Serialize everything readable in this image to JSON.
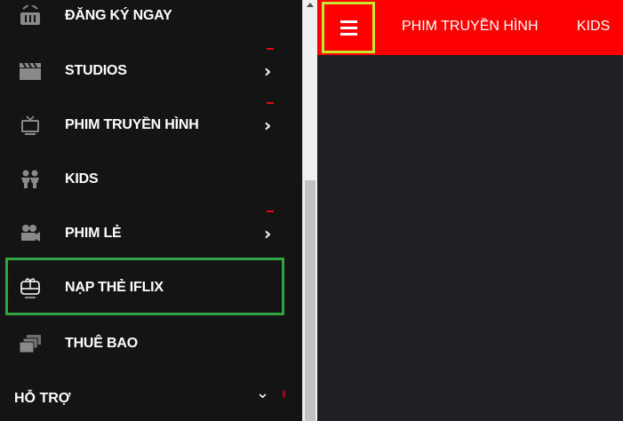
{
  "sidebar": {
    "items": [
      {
        "label": "ĐĂNG KÝ NGAY",
        "icon": "basket-icon"
      },
      {
        "label": "STUDIOS",
        "icon": "clapperboard-icon"
      },
      {
        "label": "PHIM TRUYỀN HÌNH",
        "icon": "tv-icon"
      },
      {
        "label": "KIDS",
        "icon": "kids-icon"
      },
      {
        "label": "PHIM LẺ",
        "icon": "movie-camera-icon"
      },
      {
        "label": "NẠP THẺ IFLIX",
        "icon": "gift-card-icon"
      },
      {
        "label": "THUÊ BAO",
        "icon": "subscription-stack-icon"
      }
    ],
    "support_label": "HỖ TRỢ",
    "chevron_right": "›",
    "chevron_down": "⌄"
  },
  "topbar": {
    "nav": [
      "PHIM TRUYỀN HÌNH",
      "KIDS"
    ],
    "menu_icon": "hamburger-icon"
  },
  "colors": {
    "accent": "#fe0000",
    "sidebar_bg": "#141414",
    "content_bg": "#201f23",
    "highlight_green": "#2ea442",
    "highlight_yellow": "#c8e62e"
  }
}
